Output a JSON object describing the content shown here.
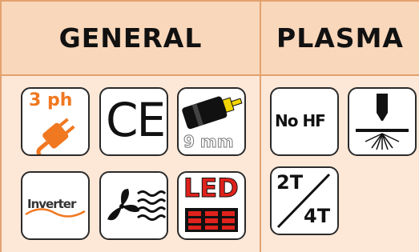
{
  "headers": {
    "general": "GENERAL",
    "plasma": "PLASMA"
  },
  "icons": {
    "three_phase": "3 ph",
    "ce_mark": "CE",
    "tungsten_size": "9 mm",
    "no_hf": "No HF",
    "plasma_torch": "plasma-torch-icon",
    "inverter": "Inverter",
    "fan_cooling": "fan-cooling-icon",
    "led": "LED",
    "trigger_2t": "2T",
    "trigger_4t": "4T"
  },
  "colors": {
    "accent": "#f07820",
    "border": "#e3a26f",
    "led_red": "#e0221c"
  }
}
